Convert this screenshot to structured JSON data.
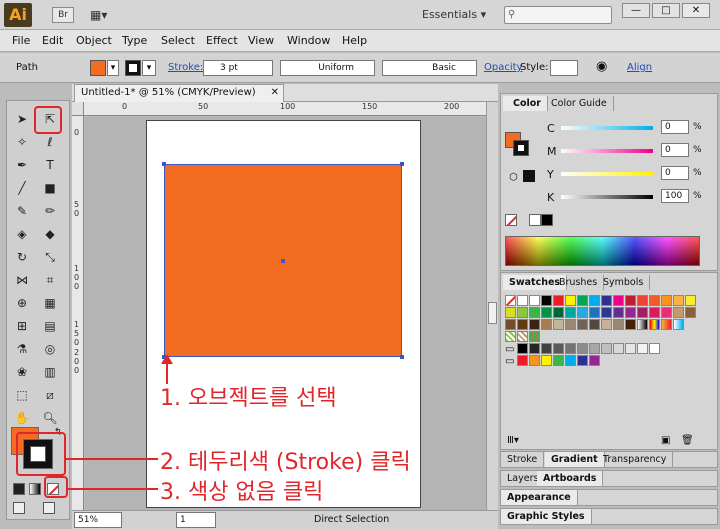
{
  "appbar": {
    "logo": "Ai",
    "bridge": "Br",
    "arrange_icon": "▦▾",
    "workspace": "Essentials",
    "workspace_caret": "▾",
    "search_placeholder": "",
    "window_buttons": [
      "—",
      "□",
      "✕"
    ]
  },
  "menu": [
    "File",
    "Edit",
    "Object",
    "Type",
    "Select",
    "Effect",
    "View",
    "Window",
    "Help"
  ],
  "control": {
    "selection": "Path",
    "stroke_label": "Stroke:",
    "stroke_weight": "3 pt",
    "profile": "Uniform",
    "brush": "Basic",
    "opacity_label": "Opacity",
    "style_label": "Style:",
    "align_label": "Align",
    "fill_color": "#f36c22"
  },
  "document": {
    "tab_title": "Untitled-1* @ 51% (CMYK/Preview)",
    "close": "✕",
    "ruler_h": [
      "0",
      "50",
      "100",
      "150",
      "200"
    ],
    "ruler_v": [
      "0",
      "5 0",
      "1 0 0",
      "1 5 0",
      "2 0 0"
    ],
    "object_color": "#f36c22",
    "selection_color": "#3a55c8"
  },
  "status": {
    "zoom": "51%",
    "page": "1",
    "tool": "Direct Selection"
  },
  "color_panel": {
    "tabs": [
      "Color",
      "Color Guide"
    ],
    "channels": [
      {
        "label": "C",
        "value": "0",
        "pos": 0
      },
      {
        "label": "M",
        "value": "0",
        "pos": 0
      },
      {
        "label": "Y",
        "value": "0",
        "pos": 0
      },
      {
        "label": "K",
        "value": "100",
        "pos": 1
      }
    ],
    "pct": "%"
  },
  "swatches_panel": {
    "tabs": [
      "Swatches",
      "Brushes",
      "Symbols"
    ]
  },
  "stroke_panel": {
    "tabs": [
      "Stroke",
      "Gradient",
      "Transparency"
    ]
  },
  "layers_panel": {
    "tabs": [
      "Layers",
      "Artboards"
    ]
  },
  "appearance_panel": {
    "title": "Appearance"
  },
  "graphic_styles_panel": {
    "title": "Graphic Styles"
  },
  "annotations": {
    "step1": "1. 오브젝트를 선택",
    "step2": "2. 테두리색 (Stroke) 클릭",
    "step3": "3. 색상 없음 클릭"
  },
  "colors": {
    "accent_red": "#e0262a",
    "orange": "#f36c22"
  }
}
